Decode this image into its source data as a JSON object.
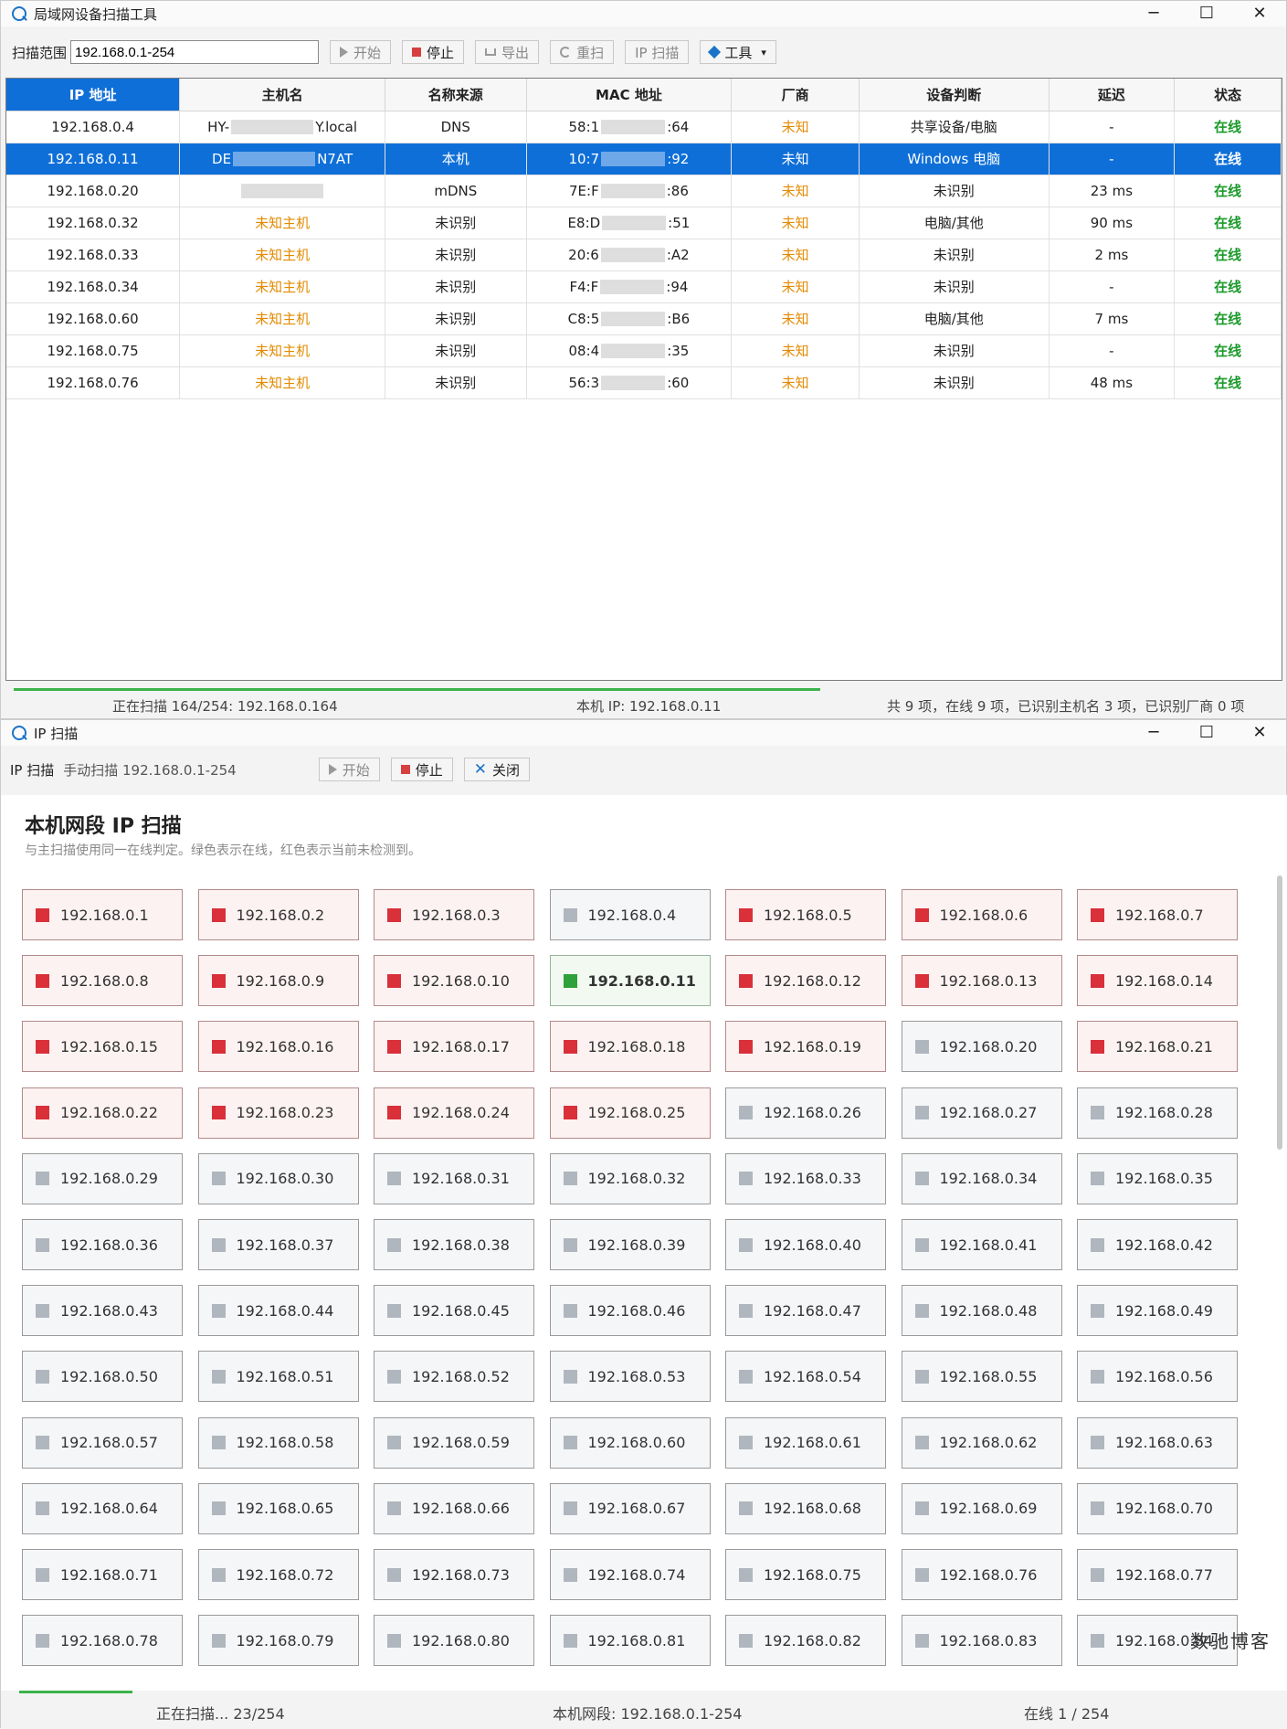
{
  "main_window": {
    "title": "局域网设备扫描工具",
    "controls": {
      "minimize": "─",
      "maximize": "☐",
      "close": "✕"
    },
    "toolbar": {
      "range_label": "扫描范围",
      "range_value": "192.168.0.1-254",
      "start": "开始",
      "stop": "停止",
      "export": "导出",
      "rescan": "重扫",
      "ip_scan": "IP 扫描",
      "tools": "工具",
      "dropdown": "▾"
    },
    "columns": [
      "IP 地址",
      "主机名",
      "名称来源",
      "MAC 地址",
      "厂商",
      "设备判断",
      "延迟",
      "状态"
    ],
    "rows": [
      {
        "ip": "192.168.0.4",
        "host_a": "HY-",
        "host_b": "Y.local",
        "source": "DNS",
        "mac_a": "58:1",
        "mac_b": ":64",
        "vendor": "未知",
        "device": "共享设备/电脑",
        "latency": "-",
        "status": "在线",
        "selected": false
      },
      {
        "ip": "192.168.0.11",
        "host_a": "DE",
        "host_b": "N7AT",
        "source": "本机",
        "mac_a": "10:7",
        "mac_b": ":92",
        "vendor": "未知",
        "device": "Windows 电脑",
        "latency": "-",
        "status": "在线",
        "selected": true
      },
      {
        "ip": "192.168.0.20",
        "host_a": "",
        "host_b": "",
        "source": "mDNS",
        "mac_a": "7E:F",
        "mac_b": ":86",
        "vendor": "未知",
        "device": "未识别",
        "latency": "23 ms",
        "status": "在线",
        "selected": false
      },
      {
        "ip": "192.168.0.32",
        "host": "未知主机",
        "source": "未识别",
        "mac_a": "E8:D",
        "mac_b": ":51",
        "vendor": "未知",
        "device": "电脑/其他",
        "latency": "90 ms",
        "status": "在线",
        "selected": false
      },
      {
        "ip": "192.168.0.33",
        "host": "未知主机",
        "source": "未识别",
        "mac_a": "20:6",
        "mac_b": ":A2",
        "vendor": "未知",
        "device": "未识别",
        "latency": "2 ms",
        "status": "在线",
        "selected": false
      },
      {
        "ip": "192.168.0.34",
        "host": "未知主机",
        "source": "未识别",
        "mac_a": "F4:F",
        "mac_b": ":94",
        "vendor": "未知",
        "device": "未识别",
        "latency": "-",
        "status": "在线",
        "selected": false
      },
      {
        "ip": "192.168.0.60",
        "host": "未知主机",
        "source": "未识别",
        "mac_a": "C8:5",
        "mac_b": ":B6",
        "vendor": "未知",
        "device": "电脑/其他",
        "latency": "7 ms",
        "status": "在线",
        "selected": false
      },
      {
        "ip": "192.168.0.75",
        "host": "未知主机",
        "source": "未识别",
        "mac_a": "08:4",
        "mac_b": ":35",
        "vendor": "未知",
        "device": "未识别",
        "latency": "-",
        "status": "在线",
        "selected": false
      },
      {
        "ip": "192.168.0.76",
        "host": "未知主机",
        "source": "未识别",
        "mac_a": "56:3",
        "mac_b": ":60",
        "vendor": "未知",
        "device": "未识别",
        "latency": "48 ms",
        "status": "在线",
        "selected": false
      }
    ],
    "progress": 0.64,
    "status": {
      "scanning": "正在扫描 164/254: 192.168.0.164",
      "local_ip": "本机 IP: 192.168.0.11",
      "summary": "共 9 项，在线 9 项，已识别主机名 3 项，已识别厂商 0 项"
    }
  },
  "ip_window": {
    "title": "IP 扫描",
    "controls": {
      "minimize": "─",
      "maximize": "☐",
      "close": "✕"
    },
    "toolbar": {
      "label": "IP 扫描",
      "desc": "手动扫描 192.168.0.1-254",
      "start": "开始",
      "stop": "停止",
      "close": "关闭"
    },
    "heading": "本机网段 IP 扫描",
    "subheading": "与主扫描使用同一在线判定。绿色表示在线，红色表示当前未检测到。",
    "cells": [
      {
        "ip": "192.168.0.1",
        "state": "red"
      },
      {
        "ip": "192.168.0.2",
        "state": "red"
      },
      {
        "ip": "192.168.0.3",
        "state": "red"
      },
      {
        "ip": "192.168.0.4",
        "state": "gray"
      },
      {
        "ip": "192.168.0.5",
        "state": "red"
      },
      {
        "ip": "192.168.0.6",
        "state": "red"
      },
      {
        "ip": "192.168.0.7",
        "state": "red"
      },
      {
        "ip": "192.168.0.8",
        "state": "red"
      },
      {
        "ip": "192.168.0.9",
        "state": "red"
      },
      {
        "ip": "192.168.0.10",
        "state": "red"
      },
      {
        "ip": "192.168.0.11",
        "state": "green"
      },
      {
        "ip": "192.168.0.12",
        "state": "red"
      },
      {
        "ip": "192.168.0.13",
        "state": "red"
      },
      {
        "ip": "192.168.0.14",
        "state": "red"
      },
      {
        "ip": "192.168.0.15",
        "state": "red"
      },
      {
        "ip": "192.168.0.16",
        "state": "red"
      },
      {
        "ip": "192.168.0.17",
        "state": "red"
      },
      {
        "ip": "192.168.0.18",
        "state": "red"
      },
      {
        "ip": "192.168.0.19",
        "state": "red"
      },
      {
        "ip": "192.168.0.20",
        "state": "gray"
      },
      {
        "ip": "192.168.0.21",
        "state": "red"
      },
      {
        "ip": "192.168.0.22",
        "state": "red"
      },
      {
        "ip": "192.168.0.23",
        "state": "red"
      },
      {
        "ip": "192.168.0.24",
        "state": "red"
      },
      {
        "ip": "192.168.0.25",
        "state": "red"
      },
      {
        "ip": "192.168.0.26",
        "state": "gray"
      },
      {
        "ip": "192.168.0.27",
        "state": "gray"
      },
      {
        "ip": "192.168.0.28",
        "state": "gray"
      },
      {
        "ip": "192.168.0.29",
        "state": "gray"
      },
      {
        "ip": "192.168.0.30",
        "state": "gray"
      },
      {
        "ip": "192.168.0.31",
        "state": "gray"
      },
      {
        "ip": "192.168.0.32",
        "state": "gray"
      },
      {
        "ip": "192.168.0.33",
        "state": "gray"
      },
      {
        "ip": "192.168.0.34",
        "state": "gray"
      },
      {
        "ip": "192.168.0.35",
        "state": "gray"
      },
      {
        "ip": "192.168.0.36",
        "state": "gray"
      },
      {
        "ip": "192.168.0.37",
        "state": "gray"
      },
      {
        "ip": "192.168.0.38",
        "state": "gray"
      },
      {
        "ip": "192.168.0.39",
        "state": "gray"
      },
      {
        "ip": "192.168.0.40",
        "state": "gray"
      },
      {
        "ip": "192.168.0.41",
        "state": "gray"
      },
      {
        "ip": "192.168.0.42",
        "state": "gray"
      },
      {
        "ip": "192.168.0.43",
        "state": "gray"
      },
      {
        "ip": "192.168.0.44",
        "state": "gray"
      },
      {
        "ip": "192.168.0.45",
        "state": "gray"
      },
      {
        "ip": "192.168.0.46",
        "state": "gray"
      },
      {
        "ip": "192.168.0.47",
        "state": "gray"
      },
      {
        "ip": "192.168.0.48",
        "state": "gray"
      },
      {
        "ip": "192.168.0.49",
        "state": "gray"
      },
      {
        "ip": "192.168.0.50",
        "state": "gray"
      },
      {
        "ip": "192.168.0.51",
        "state": "gray"
      },
      {
        "ip": "192.168.0.52",
        "state": "gray"
      },
      {
        "ip": "192.168.0.53",
        "state": "gray"
      },
      {
        "ip": "192.168.0.54",
        "state": "gray"
      },
      {
        "ip": "192.168.0.55",
        "state": "gray"
      },
      {
        "ip": "192.168.0.56",
        "state": "gray"
      },
      {
        "ip": "192.168.0.57",
        "state": "gray"
      },
      {
        "ip": "192.168.0.58",
        "state": "gray"
      },
      {
        "ip": "192.168.0.59",
        "state": "gray"
      },
      {
        "ip": "192.168.0.60",
        "state": "gray"
      },
      {
        "ip": "192.168.0.61",
        "state": "gray"
      },
      {
        "ip": "192.168.0.62",
        "state": "gray"
      },
      {
        "ip": "192.168.0.63",
        "state": "gray"
      },
      {
        "ip": "192.168.0.64",
        "state": "gray"
      },
      {
        "ip": "192.168.0.65",
        "state": "gray"
      },
      {
        "ip": "192.168.0.66",
        "state": "gray"
      },
      {
        "ip": "192.168.0.67",
        "state": "gray"
      },
      {
        "ip": "192.168.0.68",
        "state": "gray"
      },
      {
        "ip": "192.168.0.69",
        "state": "gray"
      },
      {
        "ip": "192.168.0.70",
        "state": "gray"
      },
      {
        "ip": "192.168.0.71",
        "state": "gray"
      },
      {
        "ip": "192.168.0.72",
        "state": "gray"
      },
      {
        "ip": "192.168.0.73",
        "state": "gray"
      },
      {
        "ip": "192.168.0.74",
        "state": "gray"
      },
      {
        "ip": "192.168.0.75",
        "state": "gray"
      },
      {
        "ip": "192.168.0.76",
        "state": "gray"
      },
      {
        "ip": "192.168.0.77",
        "state": "gray"
      },
      {
        "ip": "192.168.0.78",
        "state": "gray"
      },
      {
        "ip": "192.168.0.79",
        "state": "gray"
      },
      {
        "ip": "192.168.0.80",
        "state": "gray"
      },
      {
        "ip": "192.168.0.81",
        "state": "gray"
      },
      {
        "ip": "192.168.0.82",
        "state": "gray"
      },
      {
        "ip": "192.168.0.83",
        "state": "gray"
      },
      {
        "ip": "192.168.0.84",
        "state": "gray"
      }
    ],
    "progress": 0.09,
    "status": {
      "scanning": "正在扫描... 23/254",
      "segment": "本机网段: 192.168.0.1-254",
      "online": "在线 1 / 254"
    }
  },
  "watermark": "数驰博客",
  "colors": {
    "accent": "#0f6fd8",
    "online": "#1a9a2a",
    "unknown": "#e38a00",
    "offline": "#d9303a",
    "progress": "#3cb34a"
  }
}
